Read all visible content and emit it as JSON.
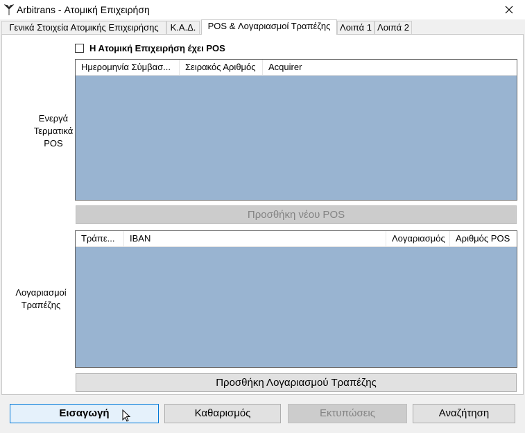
{
  "window": {
    "title": "Arbitrans - Ατομική Επιχειρήση"
  },
  "tabs": [
    {
      "label": "Γενικά Στοιχεία Ατομικής Επιχειρήσης"
    },
    {
      "label": "Κ.Α.Δ."
    },
    {
      "label": "POS & Λογαριασμοί Τραπέζης"
    },
    {
      "label": "Λοιπά 1"
    },
    {
      "label": "Λοιπά 2"
    }
  ],
  "pos_section": {
    "checkbox_label": "Η Ατομική Επιχειρήση έχει POS",
    "side_label": [
      "Ενεργά",
      "Τερματικά",
      "POS"
    ],
    "columns": [
      "Ημερομηνία Σύμβασ...",
      "Σειρακός Αριθμός",
      "Acquirer"
    ],
    "add_button": "Προσθήκη νέου POS"
  },
  "bank_section": {
    "side_label": [
      "Λογαριασμοί",
      "Τραπέζης"
    ],
    "columns": [
      "Τράπε...",
      "IBAN",
      "Λογαριασμός",
      "Αριθμός POS"
    ],
    "add_button": "Προσθήκη Λογαριασμού Τραπέζης"
  },
  "footer": {
    "insert": "Εισαγωγή",
    "clear": "Καθαρισμός",
    "prints": "Εκτυπώσεις",
    "search": "Αναζήτηση"
  }
}
